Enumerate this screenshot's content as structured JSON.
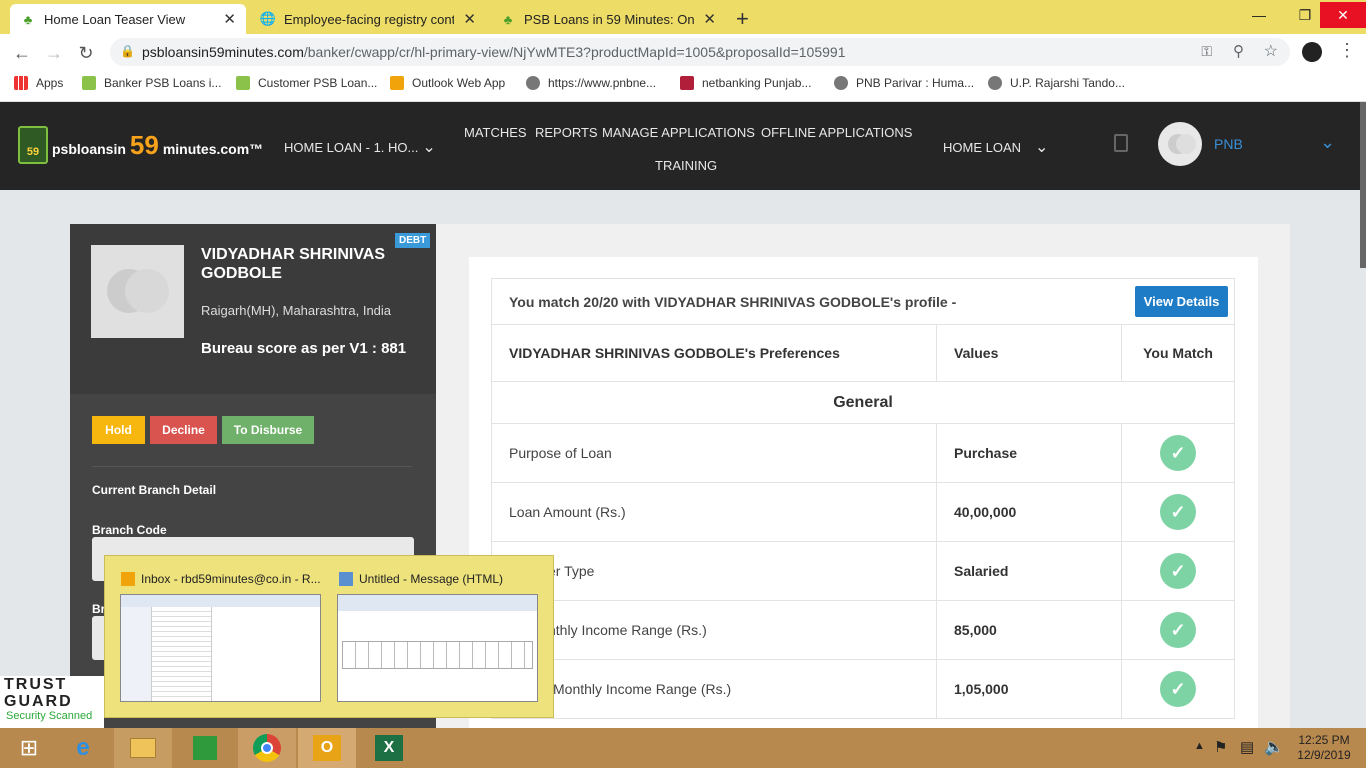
{
  "tabs": [
    {
      "label": "Home Loan Teaser View",
      "icon": "psb-logo-icon"
    },
    {
      "label": "Employee-facing registry content",
      "icon": "globe-icon"
    },
    {
      "label": "PSB Loans in 59 Minutes: Online",
      "icon": "psb-logo-icon"
    }
  ],
  "address": {
    "host": "psbloansin59minutes.com",
    "path": "/banker/cwapp/cr/hl-primary-view/NjYwMTE3?productMapId=1005&proposalId=105991"
  },
  "bookmarks": [
    "Apps",
    "Banker PSB Loans i...",
    "Customer PSB Loan...",
    "Outlook Web App",
    "https://www.pnbne...",
    "netbanking Punjab...",
    "PNB Parivar : Huma...",
    "U.P. Rajarshi Tando..."
  ],
  "header": {
    "logo_prefix": "psbloansin",
    "logo_num": "59",
    "logo_suffix": "minutes.com™",
    "product_select": "HOME LOAN - 1. HO...",
    "nav": [
      "MATCHES",
      "REPORTS",
      "MANAGE APPLICATIONS",
      "OFFLINE APPLICATIONS",
      "TRAINING"
    ],
    "loan_select": "HOME LOAN",
    "user": "PNB"
  },
  "profile": {
    "badge": "DEBT",
    "name": "VIDYADHAR SHRINIVAS GODBOLE",
    "location": "Raigarh(MH), Maharashtra, India",
    "bureau": "Bureau score as per V1 : 881",
    "actions": {
      "hold": "Hold",
      "decline": "Decline",
      "disburse": "To Disburse"
    },
    "branch_title": "Current Branch Detail",
    "branch_code_label": "Branch Code",
    "branch_name_label": "Br"
  },
  "match": {
    "summary": "You match 20/20 with VIDYADHAR SHRINIVAS GODBOLE's profile -",
    "view_details": "View Details",
    "columns": [
      "VIDYADHAR SHRINIVAS GODBOLE's Preferences",
      "Values",
      "You Match"
    ],
    "section": "General",
    "rows": [
      {
        "label": "Purpose of Loan",
        "value": "Purchase"
      },
      {
        "label": "Loan Amount (Rs.)",
        "value": "40,00,000"
      },
      {
        "label": "er Type",
        "value": "Salaried"
      },
      {
        "label": "nthly Income Range (Rs.)",
        "value": "85,000"
      },
      {
        "label": "Monthly Income Range (Rs.)",
        "value": "1,05,000"
      }
    ]
  },
  "popup": {
    "items": [
      {
        "title": "Inbox - rbd59minutes@co.in - R..."
      },
      {
        "title": "Untitled - Message (HTML)"
      }
    ]
  },
  "trustguard": {
    "line1": "TRUST",
    "line2": "GUARD",
    "line3": "Security Scanned"
  },
  "clock": {
    "time": "12:25 PM",
    "date": "12/9/2019"
  },
  "colors": {
    "accent_blue": "#1e7bc6",
    "hold": "#f7b70f",
    "decline": "#d9534f",
    "disburse": "#6fb06b",
    "match_green": "#7ed3a4"
  }
}
